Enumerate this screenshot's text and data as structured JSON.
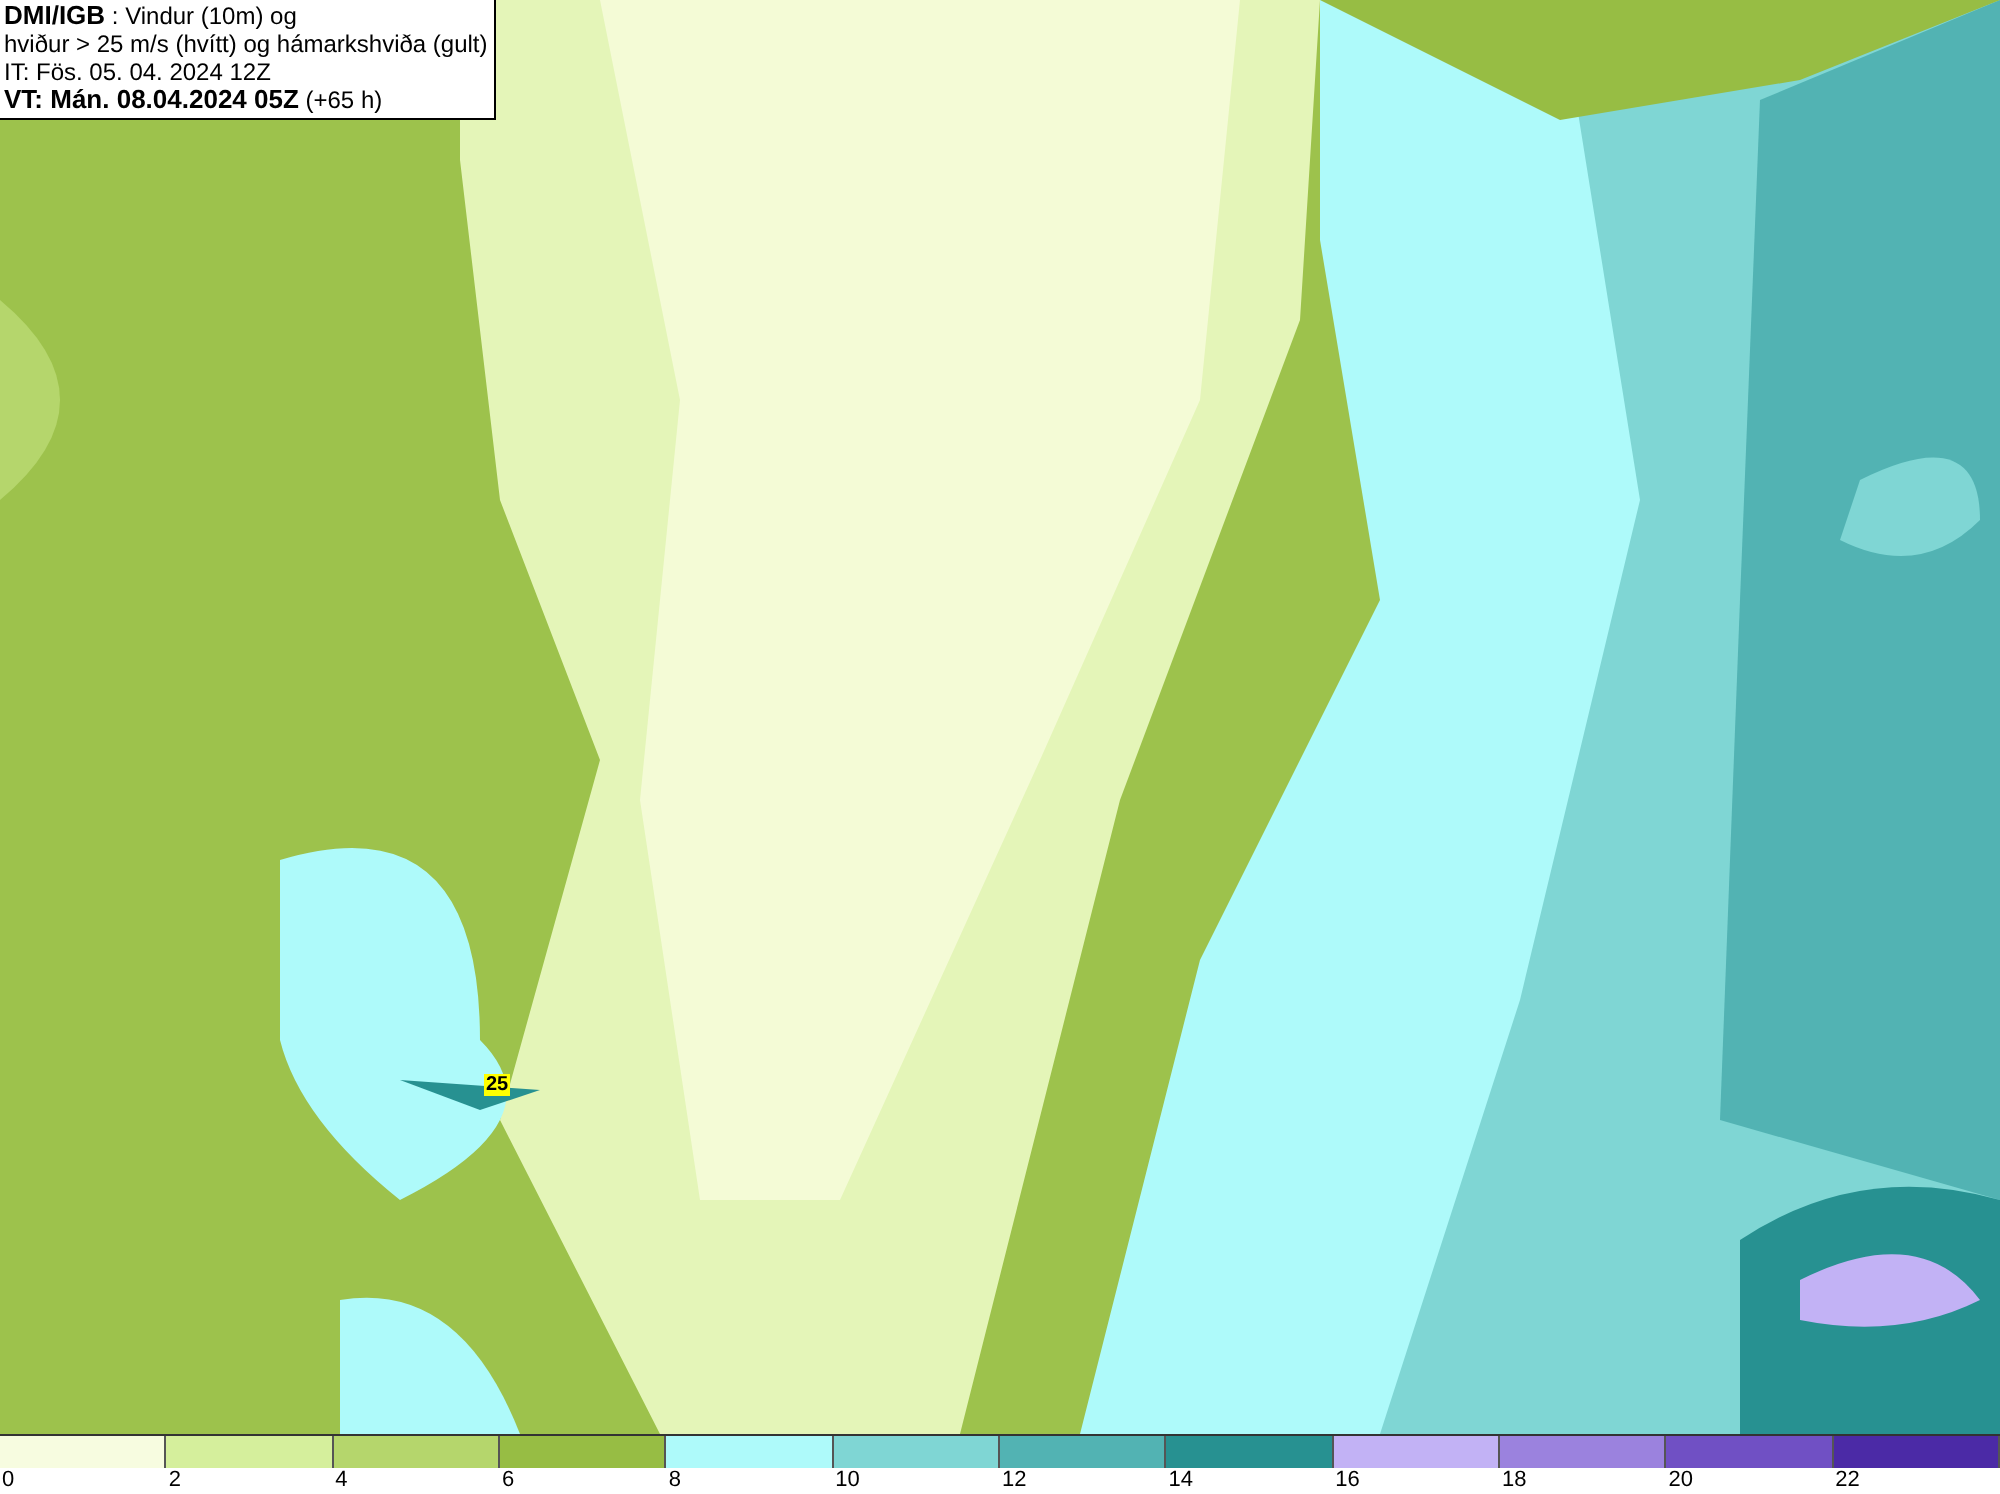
{
  "info_box": {
    "title_bold": "DMI/IGB",
    "title_rest": ": Vindur (10m) og",
    "line_2": "hviður > 25 m/s (hvítt) og hámarkshviða (gult)",
    "line_3": "IT: Fös. 05. 04. 2024 12Z",
    "valid_bold": "VT: Mán. 08.04.2024 05Z",
    "valid_rest": "(+65 h)"
  },
  "map": {
    "gust_marker": "25"
  },
  "legend": [
    {
      "label": "0",
      "color": "#f7fce0"
    },
    {
      "label": "2",
      "color": "#d5ef9c"
    },
    {
      "label": "4",
      "color": "#b5d66c"
    },
    {
      "label": "6",
      "color": "#97bd44"
    },
    {
      "label": "8",
      "color": "#aefafa"
    },
    {
      "label": "10",
      "color": "#7fd6d4"
    },
    {
      "label": "12",
      "color": "#52b3b3"
    },
    {
      "label": "14",
      "color": "#279191"
    },
    {
      "label": "16",
      "color": "#c2b2f5"
    },
    {
      "label": "18",
      "color": "#9b82de"
    },
    {
      "label": "20",
      "color": "#7050c4"
    },
    {
      "label": "22",
      "color": "#4b2aa6"
    }
  ]
}
